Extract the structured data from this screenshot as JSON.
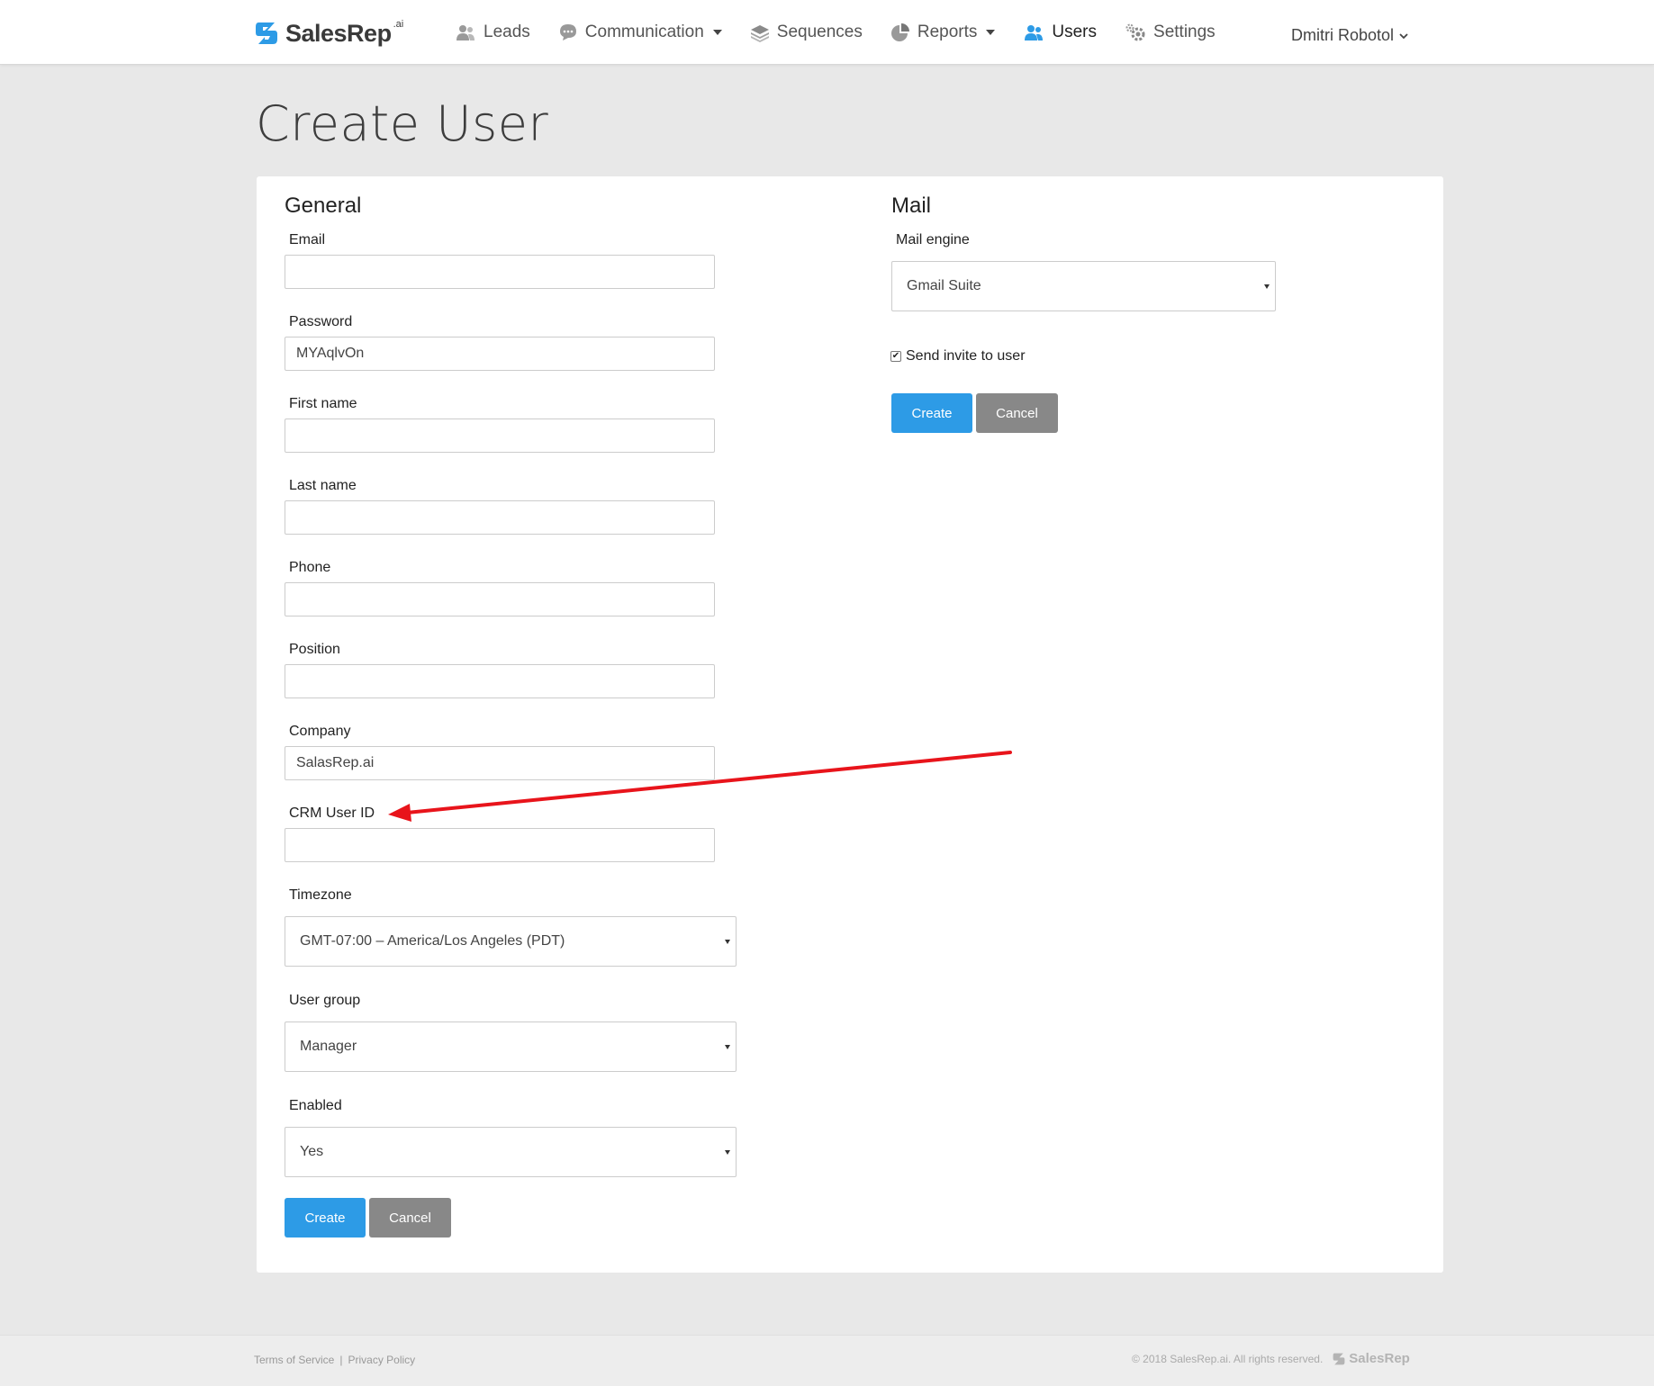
{
  "brand": {
    "name": "SalesRep",
    "suffix": ".ai"
  },
  "nav": {
    "items": [
      {
        "label": "Leads",
        "icon": "users-icon"
      },
      {
        "label": "Communication",
        "icon": "chat-icon",
        "dropdown": true
      },
      {
        "label": "Sequences",
        "icon": "layers-icon"
      },
      {
        "label": "Reports",
        "icon": "pie-chart-icon",
        "dropdown": true
      },
      {
        "label": "Users",
        "icon": "users-icon",
        "active": true
      },
      {
        "label": "Settings",
        "icon": "gears-icon"
      }
    ],
    "user_name": "Dmitri Robotol"
  },
  "page": {
    "title": "Create User"
  },
  "general": {
    "title": "General",
    "email": {
      "label": "Email",
      "value": ""
    },
    "password": {
      "label": "Password",
      "value": "MYAqlvOn"
    },
    "first_name": {
      "label": "First name",
      "value": ""
    },
    "last_name": {
      "label": "Last name",
      "value": ""
    },
    "phone": {
      "label": "Phone",
      "value": ""
    },
    "position": {
      "label": "Position",
      "value": ""
    },
    "company": {
      "label": "Company",
      "value": "SalasRep.ai"
    },
    "crm_user_id": {
      "label": "CRM User ID",
      "value": ""
    },
    "timezone": {
      "label": "Timezone",
      "value": "GMT-07:00 – America/Los Angeles (PDT)"
    },
    "user_group": {
      "label": "User group",
      "value": "Manager"
    },
    "enabled": {
      "label": "Enabled",
      "value": "Yes"
    },
    "create_label": "Create",
    "cancel_label": "Cancel"
  },
  "mail": {
    "title": "Mail",
    "engine": {
      "label": "Mail engine",
      "value": "Gmail Suite"
    },
    "send_invite": {
      "label": "Send invite to user",
      "checked": true
    },
    "create_label": "Create",
    "cancel_label": "Cancel"
  },
  "footer": {
    "terms": "Terms of Service",
    "separator": "|",
    "privacy": "Privacy Policy",
    "copyright": "© 2018 SalesRep.ai. All rights reserved."
  },
  "colors": {
    "primary": "#2d9be6",
    "secondary": "#888888",
    "annotation_arrow": "#e8141b",
    "page_bg": "#e8e8e8"
  }
}
